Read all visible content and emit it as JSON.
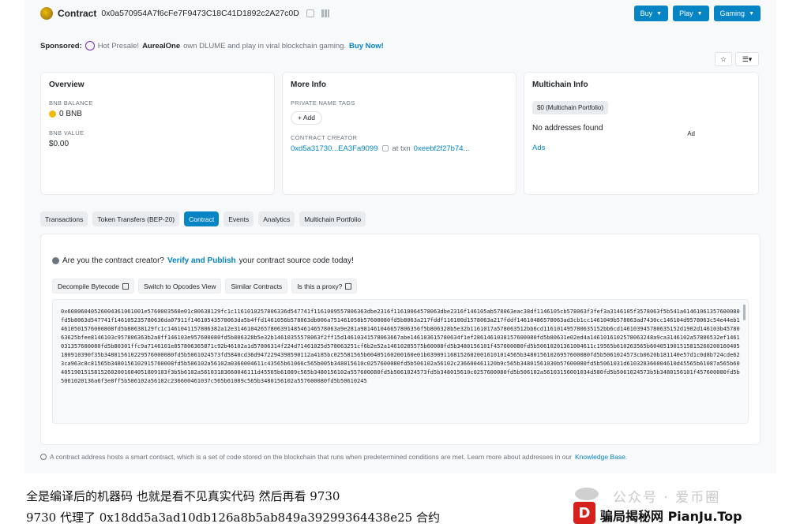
{
  "header": {
    "title": "Contract",
    "address": "0x0a570954A7f6cFe7F9473C18C41D1892c2A27c0D",
    "buttons": [
      "Buy",
      "Play",
      "Gaming"
    ]
  },
  "sponsored": {
    "label": "Sponsored:",
    "text_1": "Hot Presale!",
    "brand": "AurealOne",
    "text_2": "own DLUME and play in viral blockchain gaming.",
    "cta": "Buy Now!"
  },
  "overview": {
    "title": "Overview",
    "balance_label": "BNB BALANCE",
    "balance_value": "0 BNB",
    "value_label": "BNB VALUE",
    "value_value": "$0.00"
  },
  "more_info": {
    "title": "More Info",
    "tags_label": "PRIVATE NAME TAGS",
    "add_label": "+ Add",
    "creator_label": "CONTRACT CREATOR",
    "creator_addr": "0xd5a31730...EA3Fa9099",
    "at_txn": "at txn",
    "txn": "0xeebf2f27b74..."
  },
  "multichain": {
    "title": "Multichain Info",
    "badge": "$0 (Multichain Portfolio)",
    "no_addresses": "No addresses found",
    "ads": "Ads",
    "ad_tag": "Ad"
  },
  "tabs": [
    "Transactions",
    "Token Transfers (BEP-20)",
    "Contract",
    "Events",
    "Analytics",
    "Multichain Portfolio"
  ],
  "notice": {
    "text_1": "Are you the contract creator?",
    "link": "Verify and Publish",
    "text_2": "your contract source code today!"
  },
  "subbuttons": [
    "Decompile Bytecode",
    "Switch to Opcodes View",
    "Similar Contracts",
    "Is this a proxy?"
  ],
  "bytecode": "0x60806040526004361061001e5760003560e01c80638129fc1c1161010257806336d547741f1161009557806363dbe2316f11610064578063dbe2316f146105ab578063eac38df1146105cb578063f3fef3a3146105f3578063f5b541a61461061357600080fd5b8063d547741f146105235780636da07911f14610543578063da5b4ffd1461056b578063db006a751461058b57600080fd5b8063a217fddf116100d1578063a217fddf14610486578063ad3cb1cc1461049b578063ad7430cc146104d9578063c54e44eb14610501576000808fd5b80638129fc1c1461041157806382a12e3146104265780639148546146578063a9e281a981461046657806356f5b806328b5e32b1161017a578063512bb6cd116101495780635152bb6cd146103945780635152d1902d146103b4578063625bfee8146103c957806363b2a8ff146103e957600080fd5b806328b5e32b14610355578063f2ff15d14610341578063667abe146103615780634f1ef2861461038157600080fd5b80631e02ed4a1461016102578063248a9ca3146102a57806532ef1461031357600080fd5b80301ffc9a7146101e857806365871c92b46102a1d57806314f224d71461025d578063251cf6b2e52a14610285575b60008fd5b3480156101f457600080fd5b50610201361004611c19565b610263565b604051901515815260200160405180910390f35b348015610229576000080fd5b5061024573fd5840cd36d9472294398590112a4185bc025581565b60405160200160e01b0390911681526020016101014565b34801561026957600080fd5b5061024573cb0620b181140e57d1c0d8b724cde623ca963c8c81565b3480156102915760008fd5b506102a56102a0366004611c43565b61066c565b005b348015610c0257600080fd5b506102a56102c236600461120b9c565b34801561030b57600080fd5b5061031d610328366004610d45565b61087a565b6040519015158152602001604051809103f3b5b6102a56103183660046111d45565b61089c565b3480156102a557600080fd5b5061024573fd5b348015610c0257600080fd5b506102a56103156001034d580fd5b5061024573b5b3480156101f457600080fd5b5061020136a6f3e8ff5b506102a56102c236600461037c565b61089c565b3480156102a557600080fd5b50610245",
  "footer": {
    "text": "A contract address hosts a smart contract, which is a set of code stored on the blockchain that runs when predetermined conditions are met. Learn more about addresses in our",
    "link": "Knowledge Base."
  },
  "caption": {
    "line_1": "全是编译后的机器码 也就是看不见真实代码 然后再看 9730",
    "line_2": "9730 代理了 0x18dd5a3ad10db126a8b5ab849a39299364438e25 合约"
  },
  "watermark": {
    "wechat": "公众号 · 爱币圈",
    "logo": "D",
    "brand": "骗局揭秘网 PianJu.Top"
  }
}
